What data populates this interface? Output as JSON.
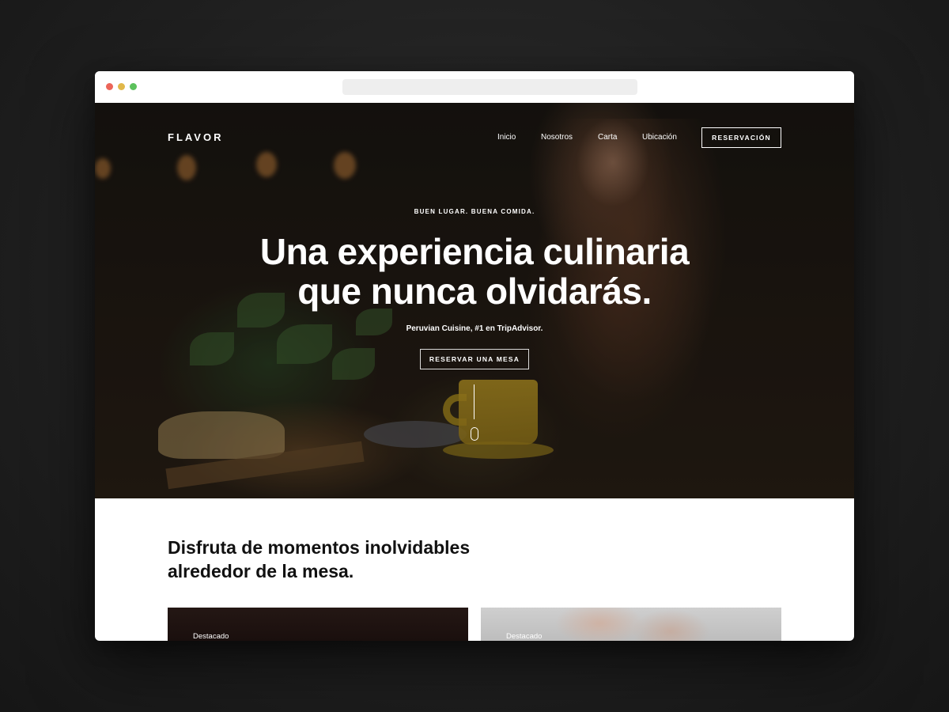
{
  "brand": {
    "logo": "FLAVOR"
  },
  "nav": {
    "links": [
      "Inicio",
      "Nosotros",
      "Carta",
      "Ubicación"
    ],
    "cta": "RESERVACIÓN"
  },
  "hero": {
    "eyebrow": "BUEN LUGAR. BUENA COMIDA.",
    "title": "Una experiencia culinaria\nque nunca olvidarás.",
    "subtitle": "Peruvian Cuisine, #1 en TripAdvisor.",
    "cta": "RESERVAR UNA MESA"
  },
  "section": {
    "title": "Disfruta de momentos inolvidables\nalrededor de la mesa.",
    "cards": [
      {
        "label": "Destacado"
      },
      {
        "label": "Destacado"
      }
    ]
  },
  "icons": {
    "window_controls": [
      "close-dot",
      "minimize-dot",
      "maximize-dot"
    ],
    "scroll": "mouse-scroll-icon"
  },
  "colors": {
    "background": "#1f1f1f",
    "hero_text": "#ffffff",
    "section_text": "#111111",
    "control_close": "#ec6559",
    "control_minimize": "#e1b84a",
    "control_maximize": "#5cc15c"
  }
}
